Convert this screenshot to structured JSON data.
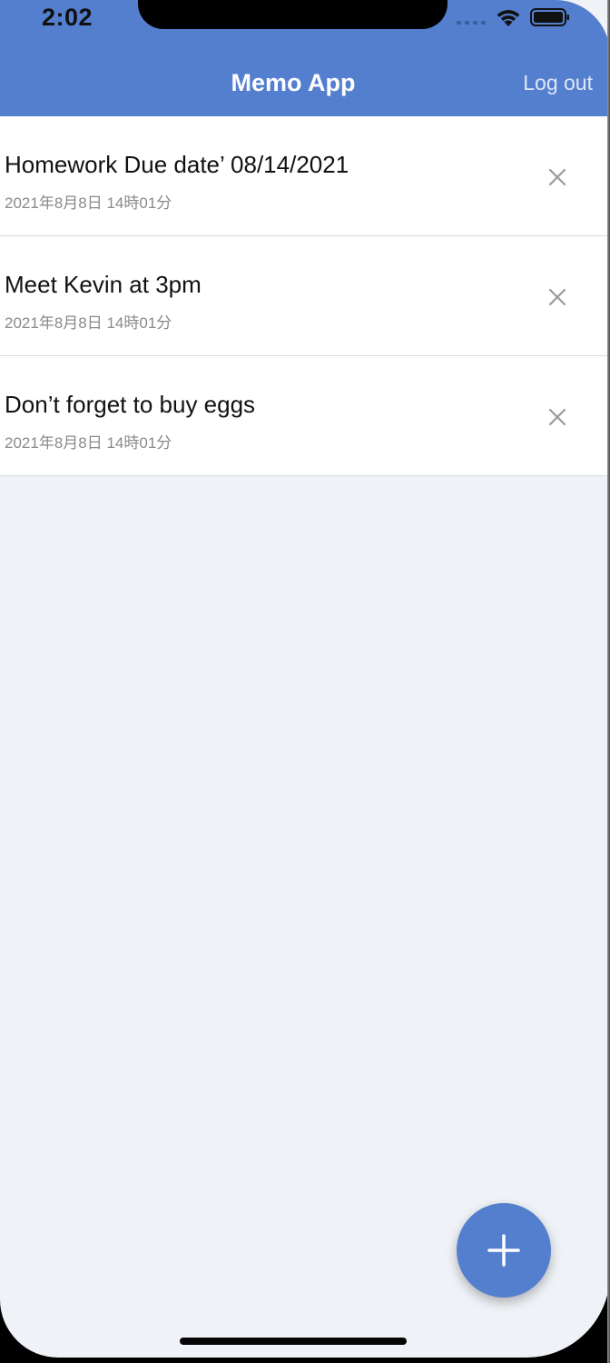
{
  "status_bar": {
    "time": "2:02"
  },
  "header": {
    "title": "Memo App",
    "logout_label": "Log out",
    "background_color": "#547fcf"
  },
  "memos": [
    {
      "title": "Homework Due date’ 08/14/2021",
      "date": "2021年8月8日 14時01分"
    },
    {
      "title": "Meet Kevin at 3pm",
      "date": "2021年8月8日 14時01分"
    },
    {
      "title": "Don’t forget to buy eggs",
      "date": "2021年8月8日 14時01分"
    }
  ],
  "icons": {
    "delete": "close-icon",
    "add": "plus-icon",
    "status": [
      "cellular-signal-icon",
      "wifi-icon",
      "battery-icon"
    ]
  },
  "colors": {
    "accent": "#547fcf",
    "background": "#eff2f6"
  }
}
